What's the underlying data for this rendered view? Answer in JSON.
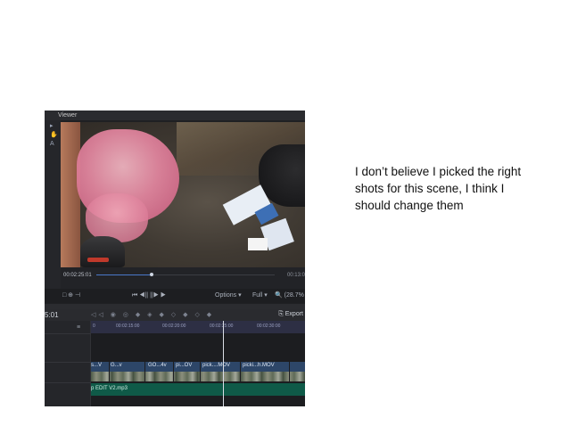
{
  "viewer": {
    "title": "Viewer",
    "tools": [
      "▸",
      "✋",
      "A"
    ],
    "timecode_current": "00:02:25:01",
    "timecode_end": "00:13:0",
    "controls": {
      "left_icons": "□ ⊕ ⊣",
      "transport": "⏮  ◀||  ||▶  ▶",
      "options": "Options ▾",
      "zoom_mode": "Full ▾",
      "zoom_level": "🔍 (28.7%"
    },
    "progress": 0.31
  },
  "timeline": {
    "timecode": "5:01",
    "tool_icons": "◁◁ ◉ ◎  ◆ ◈ ◆ ◇ ◆ ◇ ◆",
    "export_label": "⎘ Export",
    "menu_icon": "≡",
    "ruler_ticks": [
      "0",
      "00:02:15:00",
      "00:02:20:00",
      "00:02:25:00",
      "00:02:30:00"
    ],
    "clips": [
      "s...V",
      "G...v",
      "GO...4v",
      "pi...OV",
      "pick....MOV",
      "picki...h.MOV"
    ],
    "audio_clip": "p EDIT V2.mp3"
  },
  "note": {
    "text": "I don’t believe I picked the right shots for this scene, I think I should change them"
  }
}
